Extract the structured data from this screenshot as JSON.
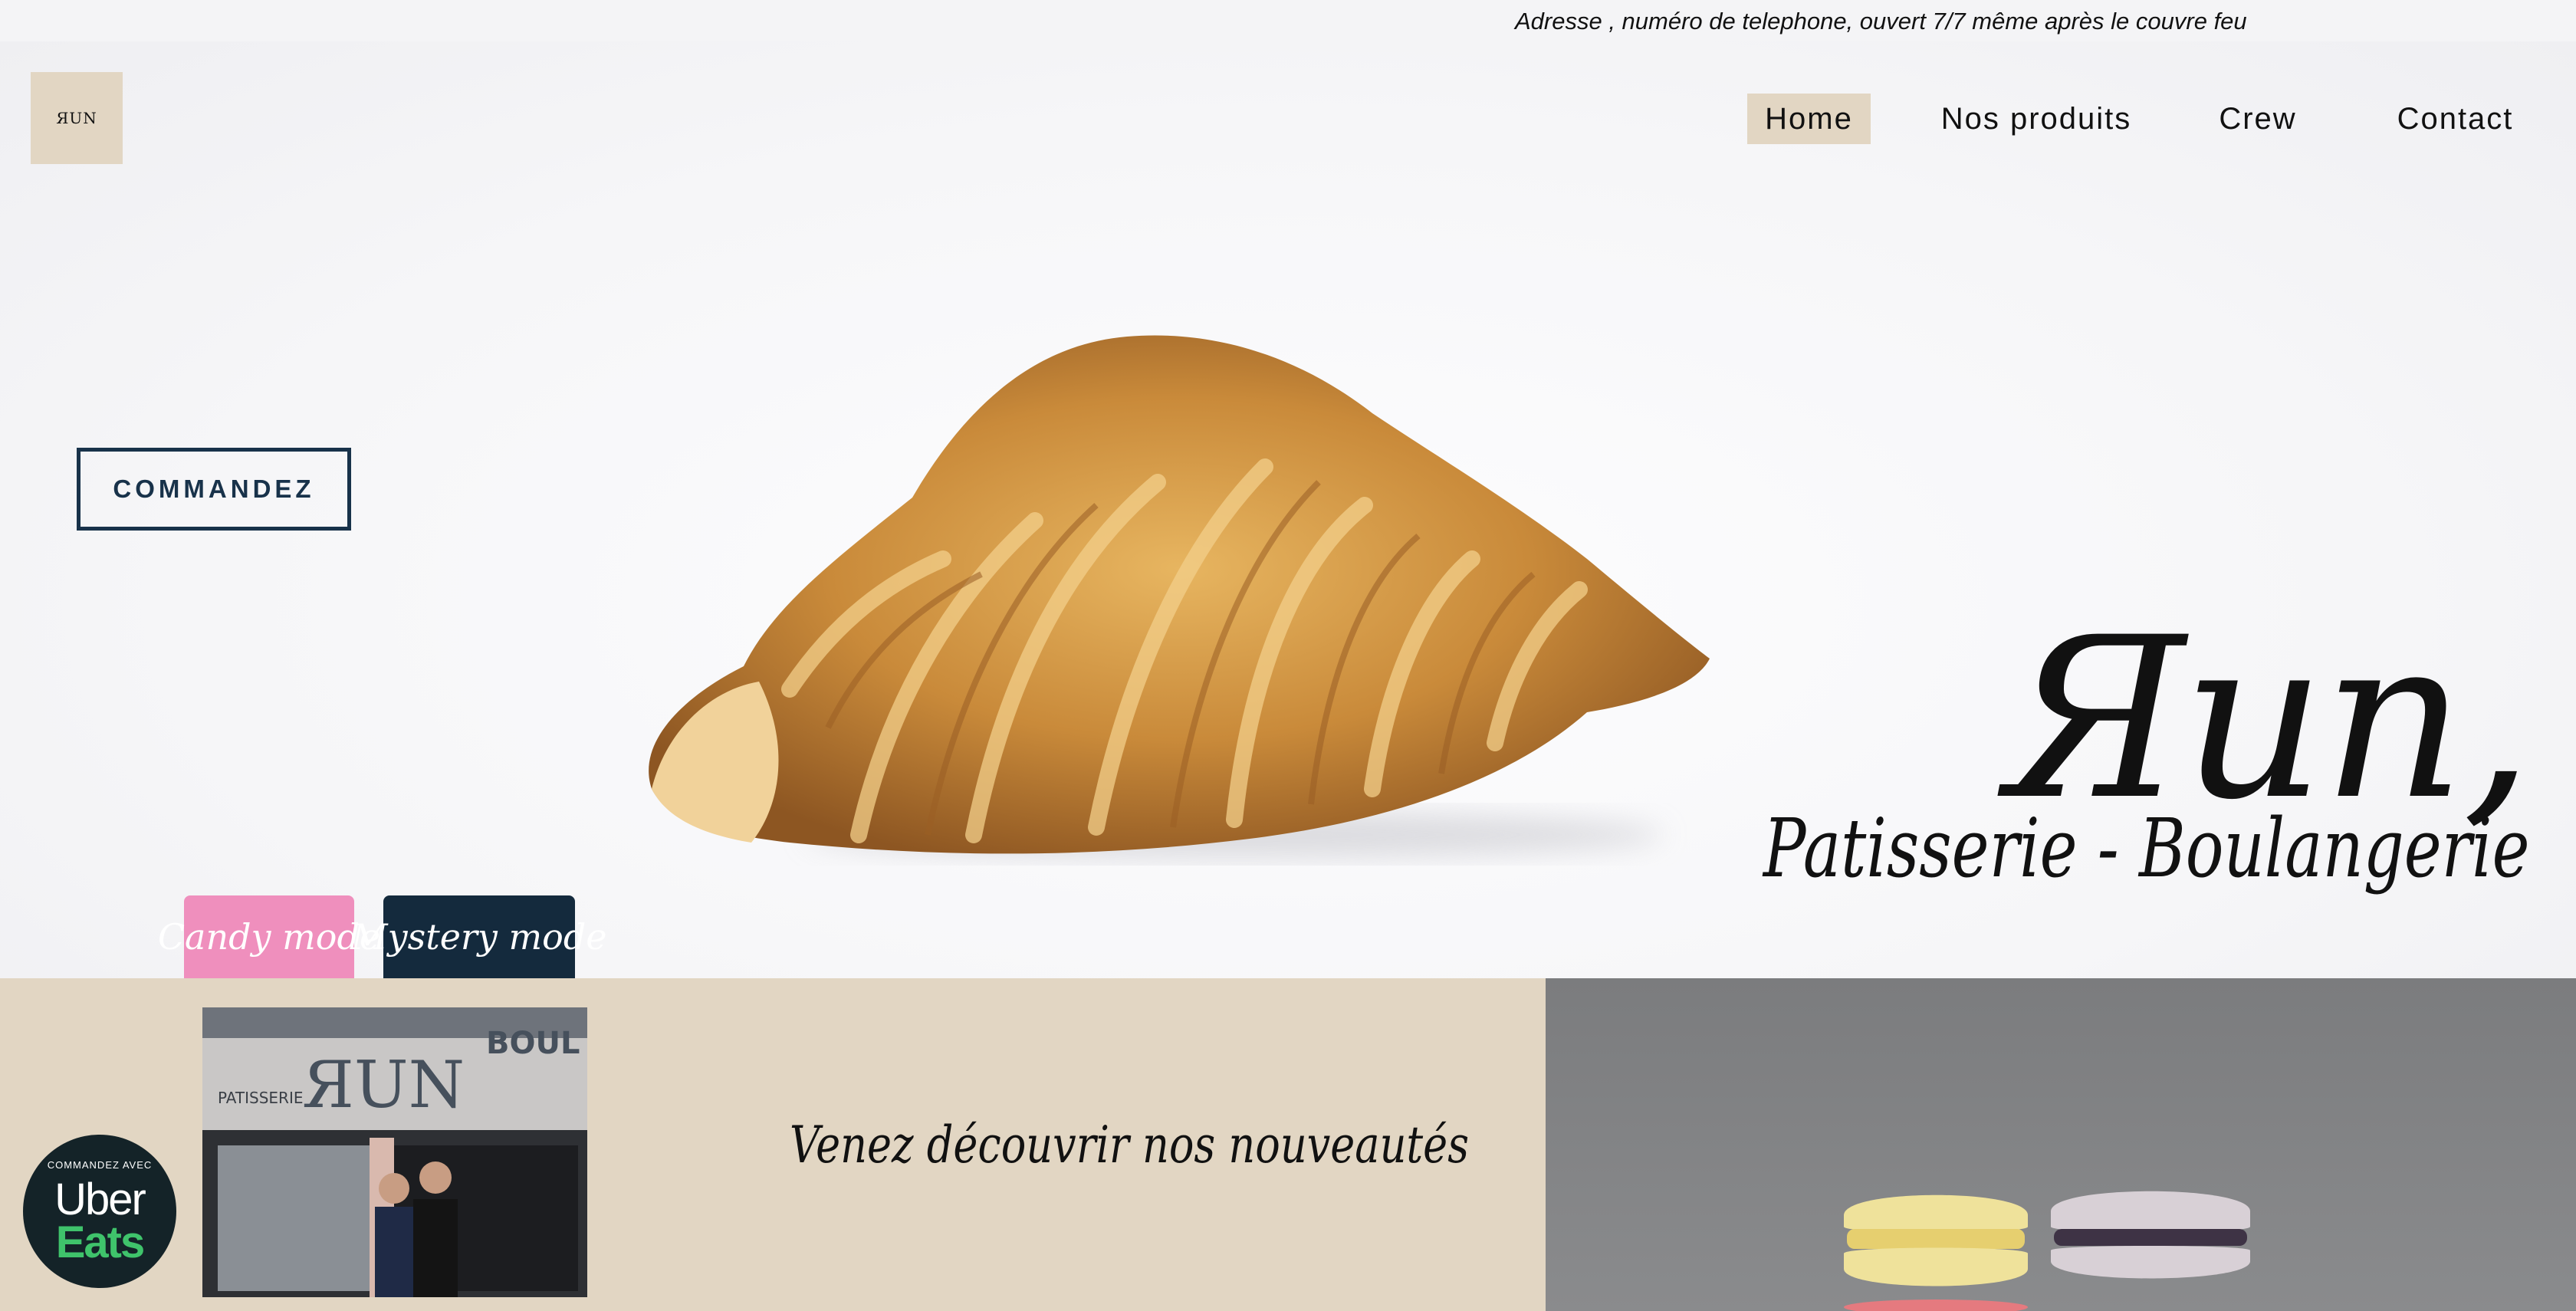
{
  "topbar": {
    "info": "Adresse , numéro de telephone, ouvert 7/7 même après le couvre feu"
  },
  "logo": {
    "text": "ЯUN"
  },
  "nav": {
    "items": [
      {
        "label": "Home",
        "active": true
      },
      {
        "label": "Nos produits",
        "active": false
      },
      {
        "label": "Crew",
        "active": false
      },
      {
        "label": "Contact",
        "active": false
      }
    ]
  },
  "hero": {
    "order_button": "COMMANDEZ",
    "brand_name": "Яun,",
    "brand_subtitle": "Patisserie - Boulangerie"
  },
  "modes": {
    "candy": "Candy mode",
    "mystery": "Mystery mode"
  },
  "uber": {
    "small": "COMMANDEZ AVEC",
    "line1": "Uber",
    "line2": "Eats"
  },
  "shop_photo": {
    "sign_left": "PATISSERIE",
    "sign_main": "ЯUN",
    "sign_right": "BOUL"
  },
  "news": {
    "text": "Venez découvrir nos nouveautés"
  },
  "colors": {
    "beige": "#e2d6c3",
    "navy": "#142a3d",
    "pink": "#ef8fbd",
    "uber_green": "#3fc36b"
  }
}
